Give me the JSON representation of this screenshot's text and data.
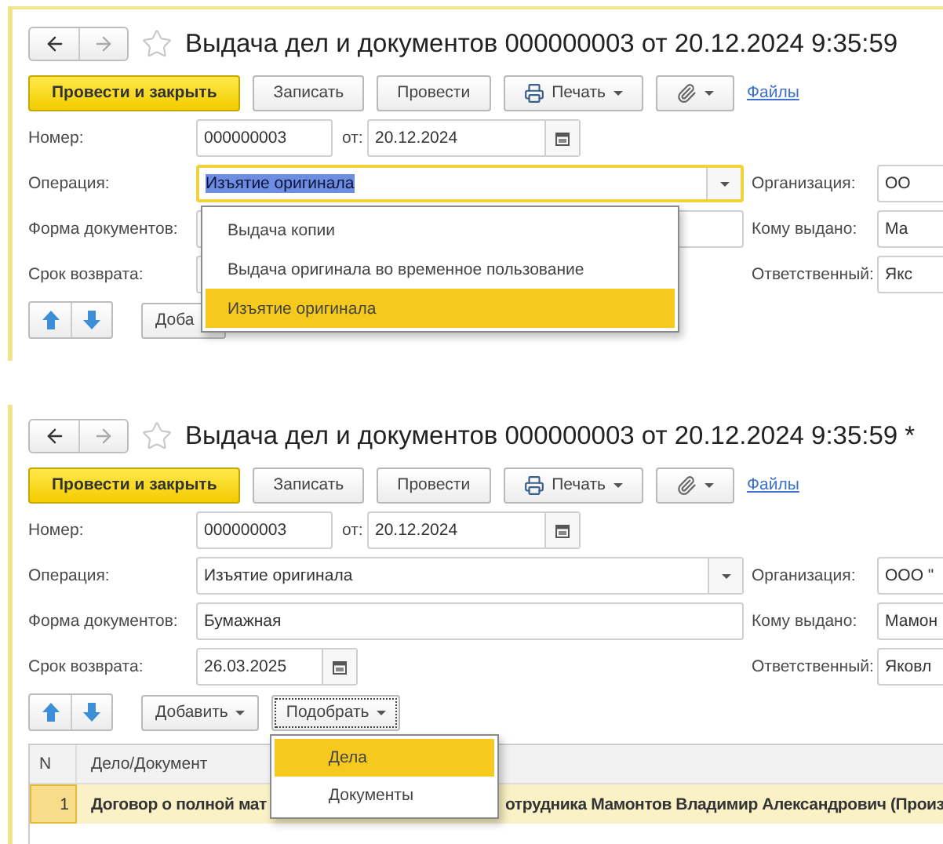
{
  "panels": [
    {
      "kind": "top",
      "title": "Выдача дел и документов 000000003 от 20.12.2024 9:35:59",
      "toolbar": [
        {
          "kind": "primary",
          "label": "Провести и закрыть"
        },
        {
          "kind": "plain",
          "label": "Записать"
        },
        {
          "kind": "plain",
          "label": "Провести"
        },
        {
          "kind": "print",
          "label": "Печать"
        },
        {
          "kind": "attach"
        },
        {
          "kind": "link",
          "label": "Файлы"
        }
      ],
      "number": {
        "label": "Номер:",
        "value": "000000003"
      },
      "date": {
        "label": "от:",
        "value": "20.12.2024"
      },
      "operation": {
        "label": "Операция:",
        "value": "Изъятие оригинала",
        "focused": true,
        "dropdown": {
          "items": [
            {
              "label": "Выдача копии",
              "selected": false
            },
            {
              "label": "Выдача оригинала во временное пользование",
              "selected": false
            },
            {
              "label": "Изъятие оригинала",
              "selected": true
            }
          ]
        }
      },
      "form_docs": {
        "label": "Форма документов:"
      },
      "return_date": {
        "label": "Срок возврата:"
      },
      "organization": {
        "label": "Организация:",
        "value": "ОО"
      },
      "recipient": {
        "label": "Кому выдано:",
        "value": "Ма"
      },
      "responsible": {
        "label": "Ответственный:",
        "value": "Якс"
      },
      "table_toolbar": [
        {
          "kind": "up"
        },
        {
          "kind": "down"
        },
        {
          "kind": "menu",
          "label": "Доба",
          "focused": false
        }
      ]
    },
    {
      "kind": "bottom",
      "title": "Выдача дел и документов 000000003 от 20.12.2024 9:35:59 *",
      "toolbar": [
        {
          "kind": "primary",
          "label": "Провести и закрыть"
        },
        {
          "kind": "plain",
          "label": "Записать"
        },
        {
          "kind": "plain",
          "label": "Провести"
        },
        {
          "kind": "print",
          "label": "Печать"
        },
        {
          "kind": "attach"
        },
        {
          "kind": "link",
          "label": "Файлы"
        }
      ],
      "number": {
        "label": "Номер:",
        "value": "000000003"
      },
      "date": {
        "label": "от:",
        "value": "20.12.2024"
      },
      "operation": {
        "label": "Операция:",
        "value": "Изъятие оригинала",
        "focused": false
      },
      "form_docs": {
        "label": "Форма документов:",
        "value": "Бумажная"
      },
      "return_date": {
        "label": "Срок возврата:",
        "value": "26.03.2025"
      },
      "organization": {
        "label": "Организация:",
        "value": "ООО \""
      },
      "recipient": {
        "label": "Кому выдано:",
        "value": "Мамон"
      },
      "responsible": {
        "label": "Ответственный:",
        "value": "Яковл"
      },
      "table_toolbar": [
        {
          "kind": "up"
        },
        {
          "kind": "down"
        },
        {
          "kind": "menu",
          "label": "Добавить",
          "focused": false
        },
        {
          "kind": "menu",
          "label": "Подобрать",
          "focused": true,
          "dropdown": {
            "items": [
              {
                "label": "Дела",
                "selected": true
              },
              {
                "label": "Документы",
                "selected": false
              }
            ]
          }
        }
      ],
      "table": {
        "columns": [
          "N",
          "Дело/Документ"
        ],
        "rows": [
          {
            "n": "1",
            "text_before": "Договор о полной мат",
            "text_after": "отрудника Мамонтов Владимир Александрович (Произ",
            "selected": true
          }
        ]
      }
    }
  ]
}
